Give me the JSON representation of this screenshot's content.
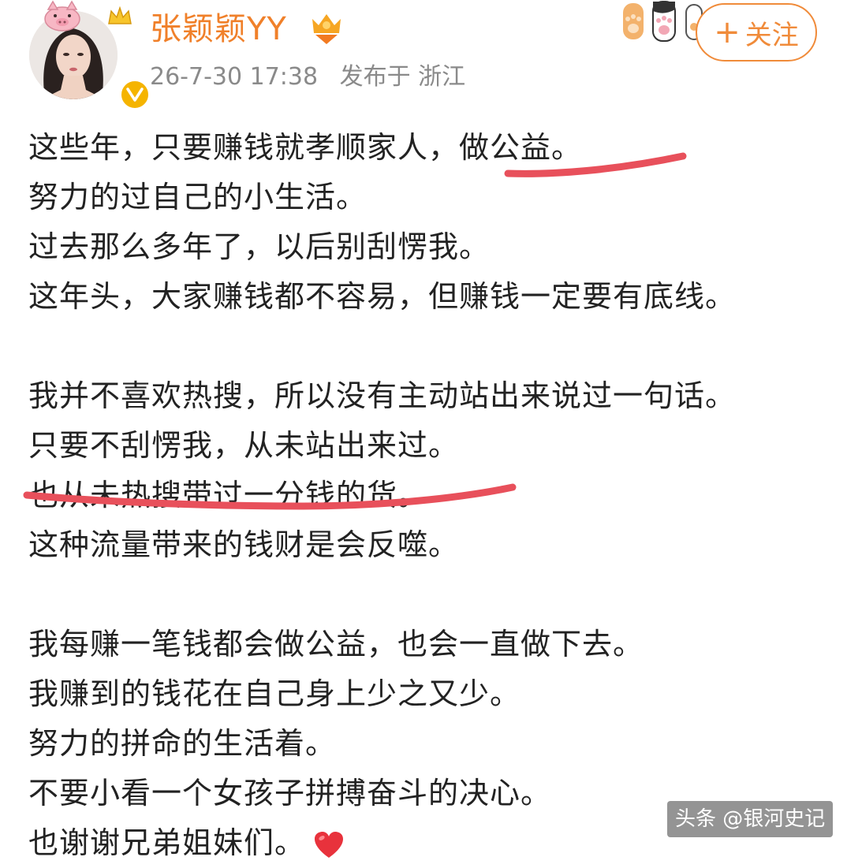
{
  "header": {
    "username": "张颖颖YY",
    "timestamp": "26-7-30 17:38",
    "location": "发布于 浙江",
    "follow_label": "关注",
    "follow_plus": "+"
  },
  "post": {
    "lines": [
      "这些年，只要赚钱就孝顺家人，做公益。",
      "努力的过自己的小生活。",
      "过去那么多年了，以后别刮愣我。",
      "这年头，大家赚钱都不容易，但赚钱一定要有底线。",
      "我并不喜欢热搜，所以没有主动站出来说过一句话。",
      "只要不刮愣我，从未站出来过。",
      "也从未热搜带过一分钱的货。",
      "这种流量带来的钱财是会反噬。",
      "我每赚一笔钱都会做公益，也会一直做下去。",
      "我赚到的钱花在自己身上少之又少。",
      "努力的拼命的生活着。",
      "不要小看一个女孩子拼搏奋斗的决心。",
      "也谢谢兄弟姐妹们。"
    ]
  },
  "watermark": "头条 @银河史记",
  "colors": {
    "username": "#f0802a",
    "follow": "#f08b3a",
    "meta": "#8a8a8a",
    "underline": "#e8505b",
    "heart": "#e8323c",
    "verified": "#f5b400"
  },
  "icons": [
    "pig-sticker-icon",
    "crown-sticker-icon",
    "verified-icon",
    "vip-badge-icon",
    "paw-sticker-icon",
    "heart-icon"
  ]
}
